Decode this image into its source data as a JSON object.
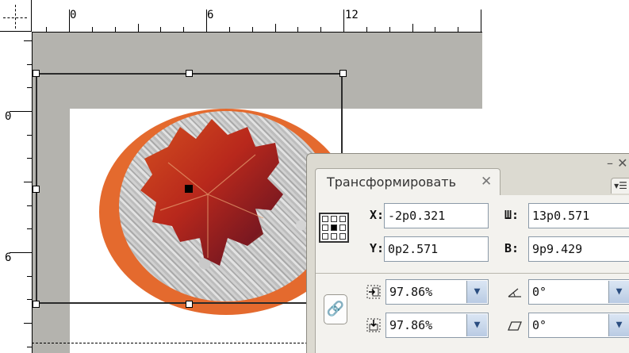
{
  "ruler": {
    "h_labels": [
      "0",
      "6",
      "12"
    ],
    "v_labels": [
      "0",
      "6"
    ]
  },
  "panel": {
    "title": "Трансформировать",
    "close_glyph": "✕",
    "minimize_glyph": "– ✕",
    "menu_glyph": "▾☰",
    "x_label": "X:",
    "x_value": "-2p0.321",
    "y_label": "Y:",
    "y_value": "0p2.571",
    "w_label": "Ш:",
    "w_value": "13p0.571",
    "h_label": "В:",
    "h_value": "9p9.429",
    "scale_x_value": "97.86%",
    "scale_y_value": "97.86%",
    "rotate_value": "0°",
    "shear_value": "0°",
    "dropdown_glyph": "▼",
    "link_glyph": "🔗"
  },
  "icons": {
    "reference_point": "reference-point-icon",
    "scale_x": "scale-x-icon",
    "scale_y": "scale-y-icon",
    "rotate": "rotate-angle-icon",
    "shear": "shear-angle-icon",
    "constrain": "constrain-proportions-icon"
  },
  "colors": {
    "ring": "#e46a2e",
    "pasteboard": "#b4b3ae",
    "panel_bg": "#f3f2ee"
  }
}
